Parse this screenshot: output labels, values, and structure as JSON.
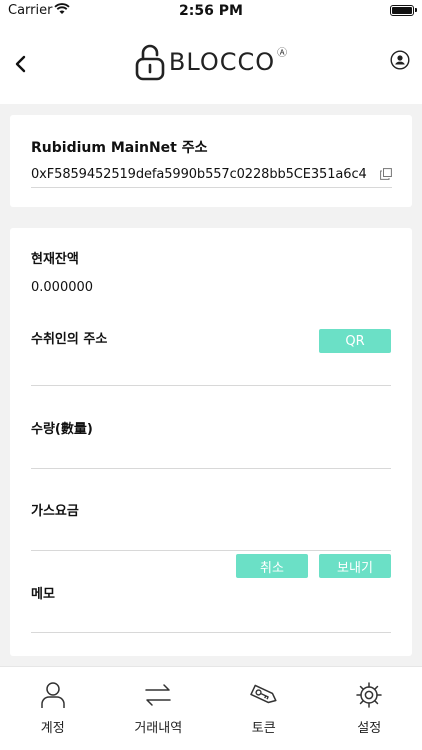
{
  "status": {
    "carrier": "Carrier",
    "time": "2:56 PM"
  },
  "header": {
    "logo_text": "BLOCCO",
    "logo_mark": "Ⓐ"
  },
  "wallet": {
    "title": "Rubidium MainNet 주소",
    "address": "0xF5859452519defa5990b557c0228bb5CE351a6c4"
  },
  "form": {
    "balance_label": "현재잔액",
    "balance_value": "0.000000",
    "recipient_label": "수취인의 주소",
    "qr_label": "QR",
    "amount_label": "수량(數量)",
    "gas_label": "가스요금",
    "cancel_label": "취소",
    "send_label": "보내기",
    "memo_label": "메모"
  },
  "tabs": [
    {
      "label": "계정",
      "icon": "person-icon"
    },
    {
      "label": "거래내역",
      "icon": "transfer-arrows-icon"
    },
    {
      "label": "토큰",
      "icon": "token-tag-icon"
    },
    {
      "label": "설정",
      "icon": "gear-icon"
    }
  ],
  "colors": {
    "accent": "#6be0c6",
    "background": "#f2f2f2"
  }
}
